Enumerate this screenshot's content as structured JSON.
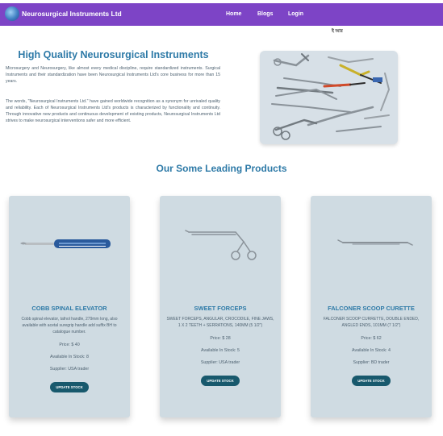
{
  "navbar": {
    "brand": "Neurosurgical Instruments Ltd",
    "links": [
      {
        "label": "Home"
      },
      {
        "label": "Blogs"
      },
      {
        "label": "Login"
      }
    ]
  },
  "user_tag": "ই আর",
  "hero": {
    "title": "High Quality Neurosurgical Instruments",
    "paragraphs": [
      "Microsurgery and Neurosurgery, like almost every medical discipline, require standardized instruments. Surgical Instruments and their standardization have been Neurosurgical Instruments Ltd's core business for more than 15 years.",
      "The words, \"Neurosurgical Instruments Ltd.\" have gained worldwide recognition as a synonym for unrivaled quality and reliability. Each of Neurosurgical Instruments Ltd's products is characterized by functionality and continuity. Through innovative new products and continuous development of existing products, Neurosurgical Instruments Ltd strives to make neurosurgical interventions safer and more efficient."
    ]
  },
  "section_title": "Our Some Leading Products",
  "products": [
    {
      "name": "COBB SPINAL ELEVATOR",
      "description": "Cobb spinal elevator, tafnol handle, 279mm long, also available with acetal suregrip handle add suffix BH to catalogue number.",
      "price": "Price: $ 40",
      "stock": "Available In Stock: 8",
      "supplier": "Supplier: USA trader",
      "button": "UPDATE STOCK",
      "icon": "elevator-instrument-icon"
    },
    {
      "name": "SWEET FORCEPS",
      "description": "SWEET FORCEPS, ANGULAR, CROCODILE, FINE JAWS, 1 X 2 TEETH + SERRATIONS, 140MM (5 1/2\")",
      "price": "Price: $ 28",
      "stock": "Available In Stock: 5",
      "supplier": "Supplier: USA trader",
      "button": "UPDATE STOCK",
      "icon": "forceps-instrument-icon"
    },
    {
      "name": "FALCONER SCOOP CURETTE",
      "description": "FALCONER SCOOP CURRETTE, DOUBLE ENDED, ANGLED ENDS, 101MM (7 1/2\")",
      "price": "Price: $ 62",
      "stock": "Available In Stock: 4",
      "supplier": "Supplier: BD trader",
      "button": "UPDATE STOCK",
      "icon": "curette-instrument-icon"
    }
  ],
  "colors": {
    "navbar": "#7d44c6",
    "heading": "#2e7aa7",
    "card_bg": "#cfdbe2",
    "button": "#18596d"
  }
}
